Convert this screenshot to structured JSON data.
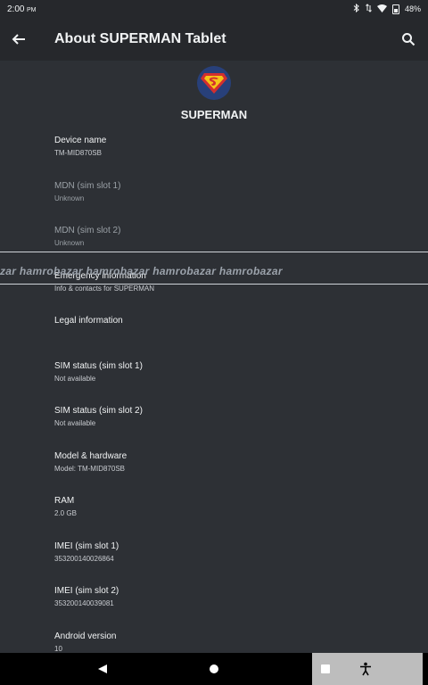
{
  "status_bar": {
    "time": "2:00",
    "time_suffix": "PM",
    "battery": "48%"
  },
  "app_bar": {
    "title": "About SUPERMAN Tablet"
  },
  "header": {
    "device_title": "SUPERMAN"
  },
  "items": [
    {
      "title": "Device name",
      "summary": "TM-MID870SB"
    },
    {
      "title": "MDN (sim slot 1)",
      "summary": "Unknown"
    },
    {
      "title": "MDN (sim slot 2)",
      "summary": "Unknown"
    },
    {
      "title": "Emergency information",
      "summary": "Info & contacts for SUPERMAN"
    },
    {
      "title": "Legal information",
      "summary": ""
    },
    {
      "title": "SIM status (sim slot 1)",
      "summary": "Not available"
    },
    {
      "title": "SIM status (sim slot 2)",
      "summary": "Not available"
    },
    {
      "title": "Model & hardware",
      "summary": "Model: TM-MID870SB"
    },
    {
      "title": "RAM",
      "summary": "2.0 GB"
    },
    {
      "title": "IMEI (sim slot 1)",
      "summary": "353200140026864"
    },
    {
      "title": "IMEI (sim slot 2)",
      "summary": "353200140039081"
    },
    {
      "title": "Android version",
      "summary": "10"
    }
  ],
  "watermark": {
    "text": "zar  hamrobazar   hamrobazar   hamrobazar   hamrobazar"
  },
  "icons": {
    "back": "arrow-back-icon",
    "search": "search-icon",
    "nav_back": "triangle-back-icon",
    "nav_home": "circle-home-icon",
    "nav_recents": "square-recents-icon",
    "accessibility": "accessibility-icon"
  }
}
